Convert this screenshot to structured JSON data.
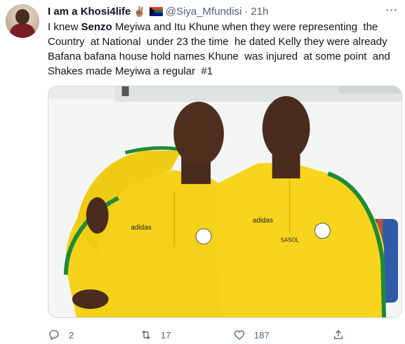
{
  "tweet": {
    "author_name": "I am a Khosi4life",
    "hand_emoji": "✌🏽",
    "handle": "@Siya_Mfundisi",
    "separator": "·",
    "time": "21h",
    "more_label": "···",
    "text_lines": [
      {
        "pre": "I knew ",
        "bold": "Senzo",
        "post": " Meyiwa and Itu Khune when they were representing  the"
      },
      {
        "pre": "Country  at National  under 23 the time  he dated Kelly they were already",
        "bold": "",
        "post": ""
      },
      {
        "pre": "Bafana bafana house hold names Khune  was injured  at some point  and",
        "bold": "",
        "post": ""
      },
      {
        "pre": "Shakes made Meyiwa a regular  #1",
        "bold": "",
        "post": ""
      }
    ],
    "jersey_text_left": "adidas",
    "jersey_text_right": "adidas",
    "sponsor_text": "SASOL"
  },
  "actions": {
    "reply_count": "2",
    "retweet_count": "17",
    "like_count": "187"
  },
  "icons": {
    "reply": "reply-icon",
    "retweet": "retweet-icon",
    "like": "heart-icon",
    "share": "share-icon",
    "flag": "south-africa-flag-icon"
  }
}
